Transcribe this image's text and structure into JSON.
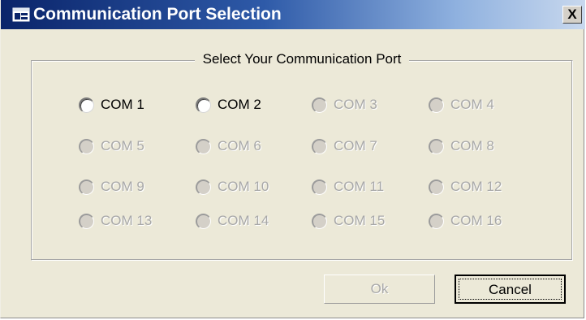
{
  "window": {
    "title": "Communication Port Selection",
    "title_icon": "dialog-app-icon",
    "close_label": "X"
  },
  "group": {
    "title": "Select Your Communication Port"
  },
  "ports": [
    {
      "label": "COM 1",
      "enabled": true
    },
    {
      "label": "COM 2",
      "enabled": true
    },
    {
      "label": "COM 3",
      "enabled": false
    },
    {
      "label": "COM 4",
      "enabled": false
    },
    {
      "label": "COM 5",
      "enabled": false
    },
    {
      "label": "COM 6",
      "enabled": false
    },
    {
      "label": "COM 7",
      "enabled": false
    },
    {
      "label": "COM 8",
      "enabled": false
    },
    {
      "label": "COM 9",
      "enabled": false
    },
    {
      "label": "COM 10",
      "enabled": false
    },
    {
      "label": "COM 11",
      "enabled": false
    },
    {
      "label": "COM 12",
      "enabled": false
    },
    {
      "label": "COM 13",
      "enabled": false
    },
    {
      "label": "COM 14",
      "enabled": false
    },
    {
      "label": "COM 15",
      "enabled": false
    },
    {
      "label": "COM 16",
      "enabled": false
    }
  ],
  "buttons": {
    "ok_label": "Ok",
    "ok_enabled": false,
    "cancel_label": "Cancel"
  },
  "colors": {
    "titlebar_start": "#0a246a",
    "titlebar_end": "#c8d8ee",
    "dialog_bg": "#ece9d8",
    "disabled_text": "#a8a8a8"
  }
}
